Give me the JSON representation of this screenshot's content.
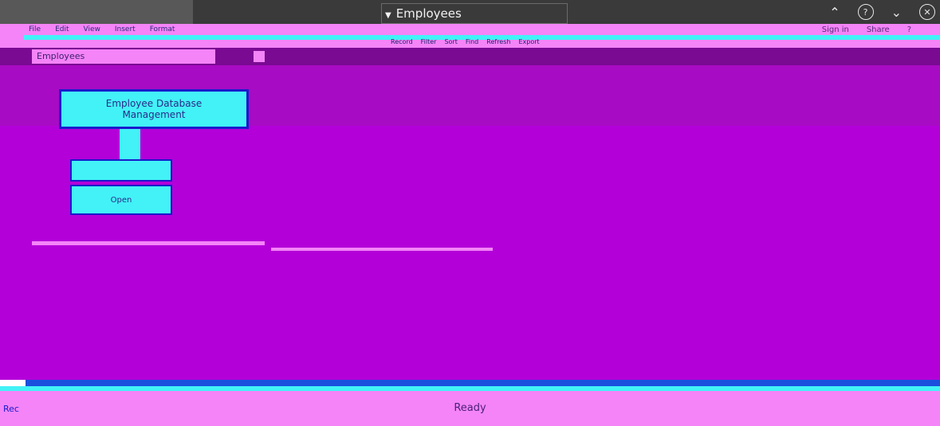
{
  "window": {
    "title": "Employees",
    "caret_icon": "caret-down-icon"
  },
  "topbar_icons": [
    "chevron-up-icon",
    "help-icon",
    "chevron-down-icon",
    "close-icon"
  ],
  "ribbon": {
    "menu": [
      "File",
      "Edit",
      "View",
      "Insert",
      "Format"
    ],
    "mid": [
      "Record",
      "Filter",
      "Sort",
      "Find",
      "Refresh",
      "Export"
    ],
    "right": [
      "Sign in",
      "Share",
      "?"
    ]
  },
  "breadcrumb": "Employees",
  "logo": {
    "line1": "Employee Database",
    "line2": "Management"
  },
  "base_label": "Open",
  "footer": {
    "status": "Ready",
    "corner": "Rec"
  },
  "colors": {
    "main": "#b300d9",
    "accent_pink": "#f484f7",
    "accent_cyan": "#42f2f7",
    "border_blue": "#1a1acc"
  }
}
